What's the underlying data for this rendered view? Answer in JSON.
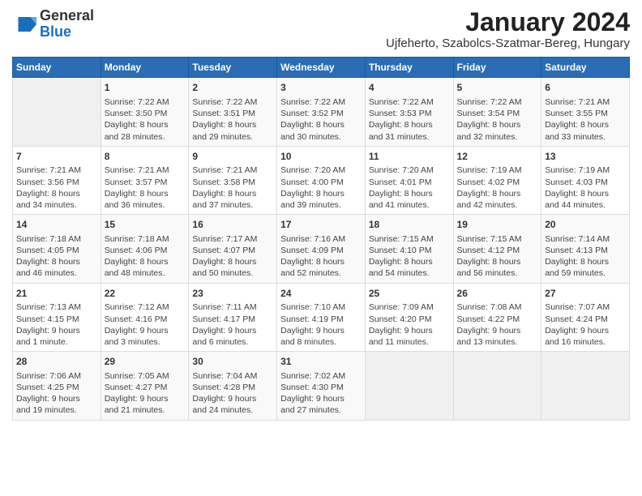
{
  "header": {
    "logo_general": "General",
    "logo_blue": "Blue",
    "month_title": "January 2024",
    "location": "Ujfeherto, Szabolcs-Szatmar-Bereg, Hungary"
  },
  "days_of_week": [
    "Sunday",
    "Monday",
    "Tuesday",
    "Wednesday",
    "Thursday",
    "Friday",
    "Saturday"
  ],
  "weeks": [
    [
      {
        "day": "",
        "info": ""
      },
      {
        "day": "1",
        "info": "Sunrise: 7:22 AM\nSunset: 3:50 PM\nDaylight: 8 hours\nand 28 minutes."
      },
      {
        "day": "2",
        "info": "Sunrise: 7:22 AM\nSunset: 3:51 PM\nDaylight: 8 hours\nand 29 minutes."
      },
      {
        "day": "3",
        "info": "Sunrise: 7:22 AM\nSunset: 3:52 PM\nDaylight: 8 hours\nand 30 minutes."
      },
      {
        "day": "4",
        "info": "Sunrise: 7:22 AM\nSunset: 3:53 PM\nDaylight: 8 hours\nand 31 minutes."
      },
      {
        "day": "5",
        "info": "Sunrise: 7:22 AM\nSunset: 3:54 PM\nDaylight: 8 hours\nand 32 minutes."
      },
      {
        "day": "6",
        "info": "Sunrise: 7:21 AM\nSunset: 3:55 PM\nDaylight: 8 hours\nand 33 minutes."
      }
    ],
    [
      {
        "day": "7",
        "info": "Sunrise: 7:21 AM\nSunset: 3:56 PM\nDaylight: 8 hours\nand 34 minutes."
      },
      {
        "day": "8",
        "info": "Sunrise: 7:21 AM\nSunset: 3:57 PM\nDaylight: 8 hours\nand 36 minutes."
      },
      {
        "day": "9",
        "info": "Sunrise: 7:21 AM\nSunset: 3:58 PM\nDaylight: 8 hours\nand 37 minutes."
      },
      {
        "day": "10",
        "info": "Sunrise: 7:20 AM\nSunset: 4:00 PM\nDaylight: 8 hours\nand 39 minutes."
      },
      {
        "day": "11",
        "info": "Sunrise: 7:20 AM\nSunset: 4:01 PM\nDaylight: 8 hours\nand 41 minutes."
      },
      {
        "day": "12",
        "info": "Sunrise: 7:19 AM\nSunset: 4:02 PM\nDaylight: 8 hours\nand 42 minutes."
      },
      {
        "day": "13",
        "info": "Sunrise: 7:19 AM\nSunset: 4:03 PM\nDaylight: 8 hours\nand 44 minutes."
      }
    ],
    [
      {
        "day": "14",
        "info": "Sunrise: 7:18 AM\nSunset: 4:05 PM\nDaylight: 8 hours\nand 46 minutes."
      },
      {
        "day": "15",
        "info": "Sunrise: 7:18 AM\nSunset: 4:06 PM\nDaylight: 8 hours\nand 48 minutes."
      },
      {
        "day": "16",
        "info": "Sunrise: 7:17 AM\nSunset: 4:07 PM\nDaylight: 8 hours\nand 50 minutes."
      },
      {
        "day": "17",
        "info": "Sunrise: 7:16 AM\nSunset: 4:09 PM\nDaylight: 8 hours\nand 52 minutes."
      },
      {
        "day": "18",
        "info": "Sunrise: 7:15 AM\nSunset: 4:10 PM\nDaylight: 8 hours\nand 54 minutes."
      },
      {
        "day": "19",
        "info": "Sunrise: 7:15 AM\nSunset: 4:12 PM\nDaylight: 8 hours\nand 56 minutes."
      },
      {
        "day": "20",
        "info": "Sunrise: 7:14 AM\nSunset: 4:13 PM\nDaylight: 8 hours\nand 59 minutes."
      }
    ],
    [
      {
        "day": "21",
        "info": "Sunrise: 7:13 AM\nSunset: 4:15 PM\nDaylight: 9 hours\nand 1 minute."
      },
      {
        "day": "22",
        "info": "Sunrise: 7:12 AM\nSunset: 4:16 PM\nDaylight: 9 hours\nand 3 minutes."
      },
      {
        "day": "23",
        "info": "Sunrise: 7:11 AM\nSunset: 4:17 PM\nDaylight: 9 hours\nand 6 minutes."
      },
      {
        "day": "24",
        "info": "Sunrise: 7:10 AM\nSunset: 4:19 PM\nDaylight: 9 hours\nand 8 minutes."
      },
      {
        "day": "25",
        "info": "Sunrise: 7:09 AM\nSunset: 4:20 PM\nDaylight: 9 hours\nand 11 minutes."
      },
      {
        "day": "26",
        "info": "Sunrise: 7:08 AM\nSunset: 4:22 PM\nDaylight: 9 hours\nand 13 minutes."
      },
      {
        "day": "27",
        "info": "Sunrise: 7:07 AM\nSunset: 4:24 PM\nDaylight: 9 hours\nand 16 minutes."
      }
    ],
    [
      {
        "day": "28",
        "info": "Sunrise: 7:06 AM\nSunset: 4:25 PM\nDaylight: 9 hours\nand 19 minutes."
      },
      {
        "day": "29",
        "info": "Sunrise: 7:05 AM\nSunset: 4:27 PM\nDaylight: 9 hours\nand 21 minutes."
      },
      {
        "day": "30",
        "info": "Sunrise: 7:04 AM\nSunset: 4:28 PM\nDaylight: 9 hours\nand 24 minutes."
      },
      {
        "day": "31",
        "info": "Sunrise: 7:02 AM\nSunset: 4:30 PM\nDaylight: 9 hours\nand 27 minutes."
      },
      {
        "day": "",
        "info": ""
      },
      {
        "day": "",
        "info": ""
      },
      {
        "day": "",
        "info": ""
      }
    ]
  ]
}
